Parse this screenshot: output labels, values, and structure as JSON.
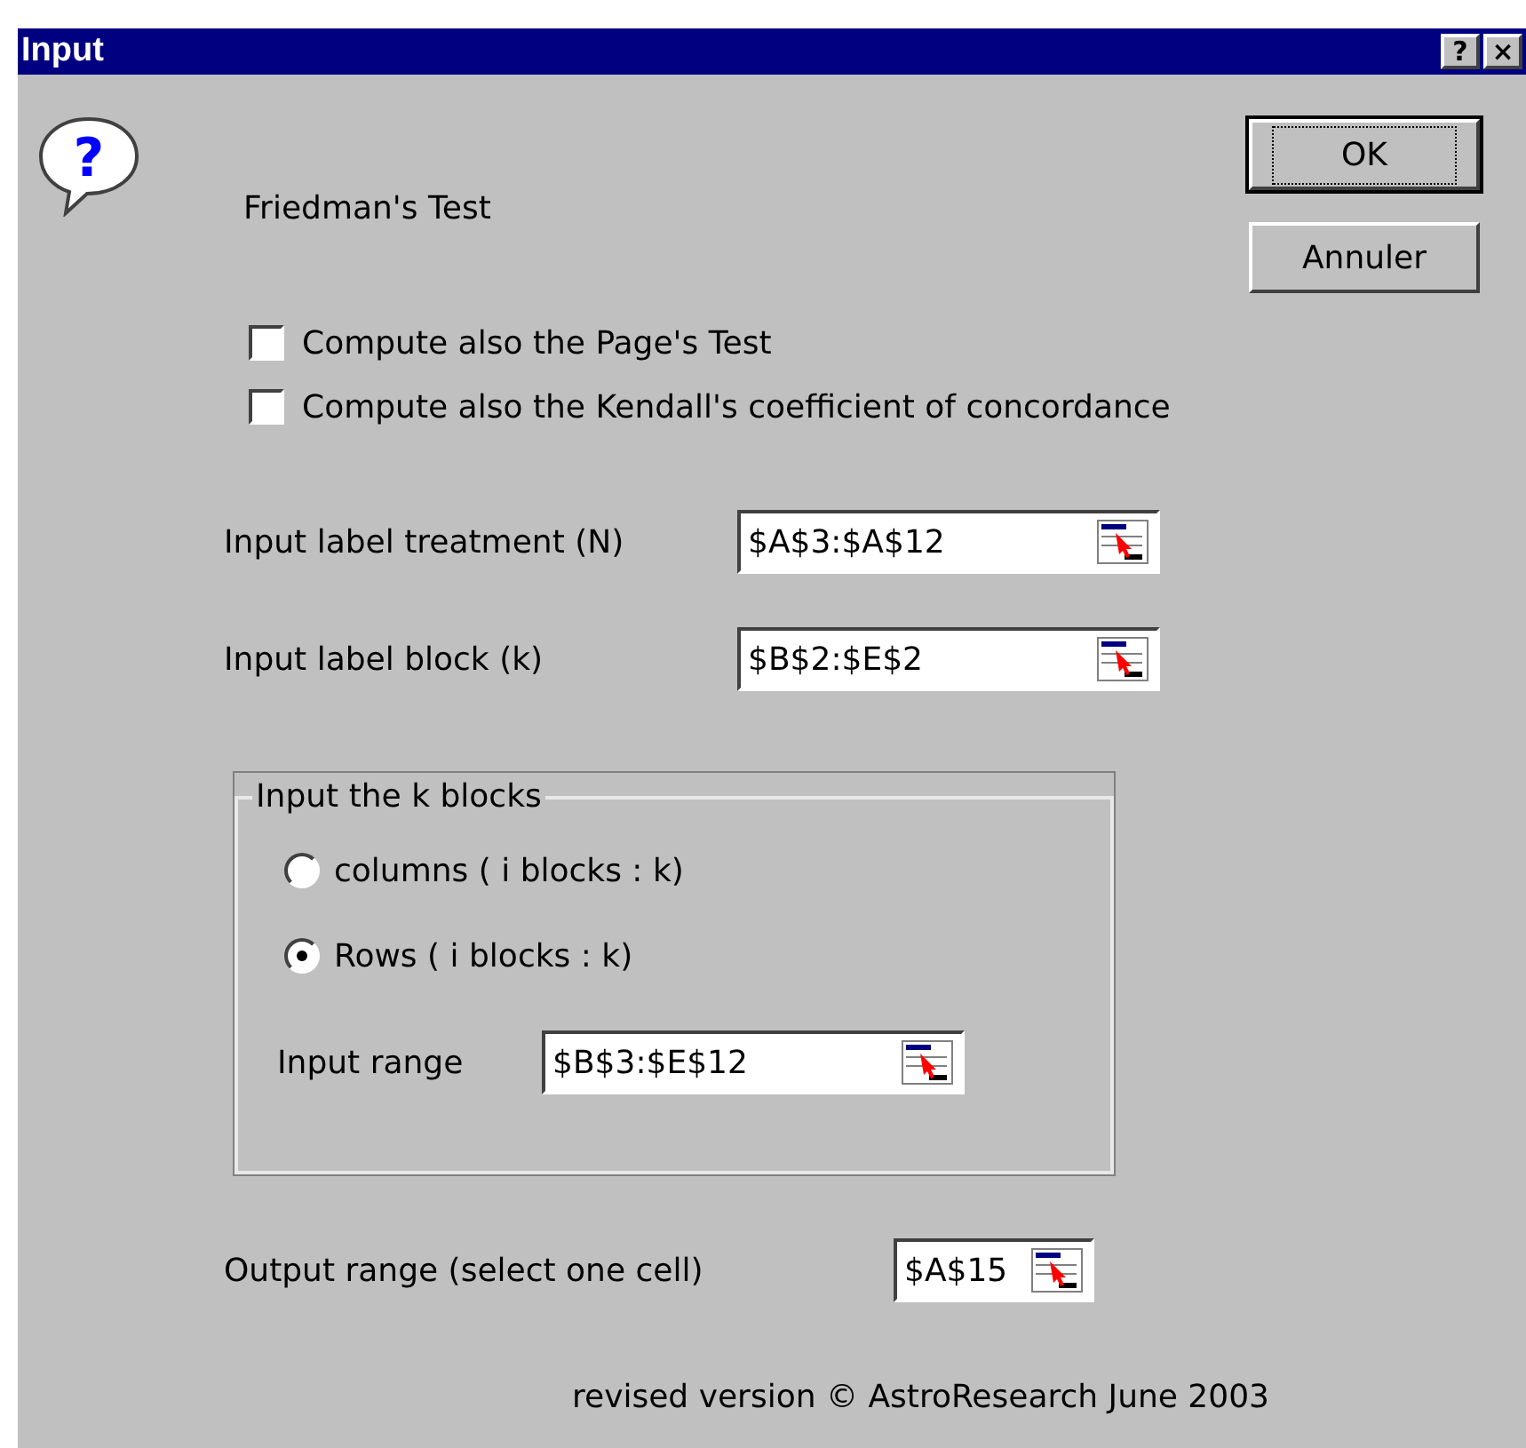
{
  "window": {
    "title": "Input",
    "title_buttons": [
      "?",
      "×"
    ]
  },
  "help_mark": "?",
  "heading": "Friedman's Test",
  "buttons": [
    {
      "label": "OK",
      "focused": true
    },
    {
      "label": "Annuler",
      "focused": false
    }
  ],
  "options": [
    {
      "label": "Compute also the Page's Test",
      "checked": false
    },
    {
      "label": "Compute also the Kendall's coefficient of concordance",
      "checked": false
    }
  ],
  "fields": [
    {
      "label": "Input label treatment (N)",
      "value": "$A$3:$A$12"
    },
    {
      "label": "Input label block (k)",
      "value": "$B$2:$E$2"
    }
  ],
  "group": {
    "title": "Input the k blocks",
    "radios": [
      {
        "label": "columns ( i blocks : k)",
        "selected": false
      },
      {
        "label": "Rows ( i blocks : k)",
        "selected": true
      }
    ],
    "range": {
      "label": "Input range",
      "value": "$B$3:$E$12"
    }
  },
  "output": {
    "label": "Output range (select one cell)",
    "value": "$A$15"
  },
  "footer": "revised version © AstroResearch June 2003"
}
